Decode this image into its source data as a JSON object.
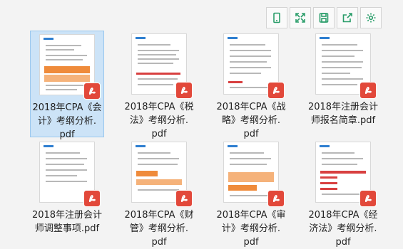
{
  "toolbar": {
    "buttons": [
      {
        "name": "tablet-view-icon"
      },
      {
        "name": "fullscreen-icon"
      },
      {
        "name": "save-icon"
      },
      {
        "name": "share-icon"
      },
      {
        "name": "settings-gear-icon"
      }
    ]
  },
  "files": [
    {
      "line1": "2018年CPA《会",
      "line2": "计》考纲分析.",
      "line3": "pdf",
      "selected": true
    },
    {
      "line1": "2018年CPA《税",
      "line2": "法》考纲分析.",
      "line3": "pdf"
    },
    {
      "line1": "2018年CPA《战",
      "line2": "略》考纲分析.",
      "line3": "pdf"
    },
    {
      "line1": "2018年注册会计",
      "line2": "师报名简章.pdf",
      "line3": ""
    },
    {
      "line1": "2018年注册会计",
      "line2": "师调整事项.pdf",
      "line3": ""
    },
    {
      "line1": "2018年CPA《财",
      "line2": "管》考纲分析.",
      "line3": "pdf"
    },
    {
      "line1": "2018年CPA《审",
      "line2": "计》考纲分析.",
      "line3": "pdf"
    },
    {
      "line1": "2018年CPA《经",
      "line2": "济法》考纲分析.",
      "line3": "pdf"
    }
  ],
  "colors": {
    "accent": "#2a9d6a",
    "pdf_badge": "#e2483a",
    "selection": "#cce3f7"
  }
}
